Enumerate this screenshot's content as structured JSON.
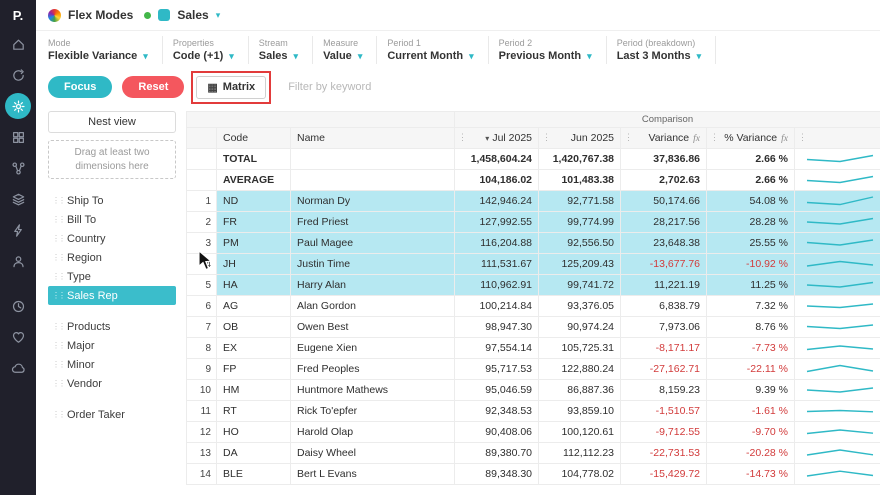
{
  "colors": {
    "accent_teal": "#2fb9c6",
    "reset_red": "#f4575e",
    "row_highlight": "#b6e8f2",
    "negative_value": "#d23b3b",
    "annotation_red": "#e23b3b",
    "sparkline": "#2fb9c6"
  },
  "app": {
    "logo_text": "P.",
    "title": "Flex Modes",
    "database": "Sales"
  },
  "sidebar": {
    "icons": [
      "home-icon",
      "refresh-icon",
      "tools-icon",
      "grid-icon",
      "connections-icon",
      "layers-icon",
      "bolt-icon",
      "users-icon",
      "history-icon",
      "heart-icon",
      "cloud-icon"
    ],
    "active_icon": "tools-icon"
  },
  "toolbar": {
    "controls": [
      {
        "label": "Mode",
        "value": "Flexible Variance"
      },
      {
        "label": "Properties",
        "value": "Code (+1)"
      },
      {
        "label": "Stream",
        "value": "Sales"
      },
      {
        "label": "Measure",
        "value": "Value"
      },
      {
        "label": "Period 1",
        "value": "Current Month"
      },
      {
        "label": "Period 2",
        "value": "Previous Month"
      },
      {
        "label": "Period (breakdown)",
        "value": "Last 3 Months"
      }
    ]
  },
  "actions": {
    "focus_label": "Focus",
    "reset_label": "Reset",
    "matrix_label": "Matrix",
    "filter_placeholder": "Filter by keyword"
  },
  "nest_panel": {
    "title": "Nest view",
    "drop_hint": "Drag at least two dimensions here",
    "active_item": "Sales Rep",
    "groups": [
      [
        "Ship To",
        "Bill To",
        "Country",
        "Region",
        "Type",
        "Sales Rep"
      ],
      [
        "Products",
        "Major",
        "Minor",
        "Vendor"
      ],
      [
        "Order Taker"
      ]
    ]
  },
  "table": {
    "group_header": "Comparison",
    "columns": [
      {
        "key": "code",
        "label": "Code",
        "align": "left"
      },
      {
        "key": "name",
        "label": "Name",
        "align": "left"
      },
      {
        "key": "jul-2025",
        "label": "Jul 2025",
        "align": "right",
        "sorted": true,
        "menu": true
      },
      {
        "key": "jun-2025",
        "label": "Jun 2025",
        "align": "right",
        "menu": true
      },
      {
        "key": "variance",
        "label": "Variance",
        "align": "right",
        "fx": true,
        "menu": true
      },
      {
        "key": "pct-variance",
        "label": "% Variance",
        "align": "right",
        "fx": true,
        "menu": true
      },
      {
        "key": "sparkline",
        "label": "",
        "align": "right",
        "menu": true,
        "spark": true
      }
    ],
    "summary_rows": [
      {
        "label": "TOTAL",
        "jul": "1,458,604.24",
        "jun": "1,420,767.38",
        "variance": "37,836.86",
        "pct_variance": "2.66 %",
        "spark": [
          0.45,
          0.25,
          0.85
        ]
      },
      {
        "label": "AVERAGE",
        "jul": "104,186.02",
        "jun": "101,483.38",
        "variance": "2,702.63",
        "pct_variance": "2.66 %",
        "spark": [
          0.45,
          0.25,
          0.85
        ]
      }
    ],
    "rows": [
      {
        "n": 1,
        "code": "ND",
        "name": "Norman Dy",
        "jul": "142,946.24",
        "jun": "92,771.58",
        "variance": "50,174.66",
        "pct_variance": "54.08 %",
        "highlight": true,
        "spark": [
          0.35,
          0.15,
          0.9
        ]
      },
      {
        "n": 2,
        "code": "FR",
        "name": "Fred Priest",
        "jul": "127,992.55",
        "jun": "99,774.99",
        "variance": "28,217.56",
        "pct_variance": "28.28 %",
        "highlight": true,
        "spark": [
          0.5,
          0.3,
          0.85
        ]
      },
      {
        "n": 3,
        "code": "PM",
        "name": "Paul Magee",
        "jul": "116,204.88",
        "jun": "92,556.50",
        "variance": "23,648.38",
        "pct_variance": "25.55 %",
        "highlight": true,
        "spark": [
          0.55,
          0.3,
          0.8
        ]
      },
      {
        "n": 4,
        "code": "JH",
        "name": "Justin Time",
        "jul": "111,531.67",
        "jun": "125,209.43",
        "variance": "-13,677.76",
        "pct_variance": "-10.92 %",
        "highlight": true,
        "spark": [
          0.3,
          0.75,
          0.4
        ]
      },
      {
        "n": 5,
        "code": "HA",
        "name": "Harry Alan",
        "jul": "110,962.91",
        "jun": "99,741.72",
        "variance": "11,221.19",
        "pct_variance": "11.25 %",
        "highlight": true,
        "spark": [
          0.5,
          0.3,
          0.75
        ]
      },
      {
        "n": 6,
        "code": "AG",
        "name": "Alan Gordon",
        "jul": "100,214.84",
        "jun": "93,376.05",
        "variance": "6,838.79",
        "pct_variance": "7.32 %",
        "highlight": false,
        "spark": [
          0.5,
          0.35,
          0.7
        ]
      },
      {
        "n": 7,
        "code": "OB",
        "name": "Owen Best",
        "jul": "98,947.30",
        "jun": "90,974.24",
        "variance": "7,973.06",
        "pct_variance": "8.76 %",
        "highlight": false,
        "spark": [
          0.55,
          0.35,
          0.7
        ]
      },
      {
        "n": 8,
        "code": "EX",
        "name": "Eugene Xien",
        "jul": "97,554.14",
        "jun": "105,725.31",
        "variance": "-8,171.17",
        "pct_variance": "-7.73 %",
        "highlight": false,
        "spark": [
          0.35,
          0.7,
          0.4
        ]
      },
      {
        "n": 9,
        "code": "FP",
        "name": "Fred Peoples",
        "jul": "95,717.53",
        "jun": "122,880.24",
        "variance": "-27,162.71",
        "pct_variance": "-22.11 %",
        "highlight": false,
        "spark": [
          0.25,
          0.85,
          0.3
        ]
      },
      {
        "n": 10,
        "code": "HM",
        "name": "Huntmore Mathews",
        "jul": "95,046.59",
        "jun": "86,887.36",
        "variance": "8,159.23",
        "pct_variance": "9.39 %",
        "highlight": false,
        "spark": [
          0.5,
          0.3,
          0.7
        ]
      },
      {
        "n": 11,
        "code": "RT",
        "name": "Rick To'epfer",
        "jul": "92,348.53",
        "jun": "93,859.10",
        "variance": "-1,510.57",
        "pct_variance": "-1.61 %",
        "highlight": false,
        "spark": [
          0.45,
          0.55,
          0.42
        ]
      },
      {
        "n": 12,
        "code": "HO",
        "name": "Harold Olap",
        "jul": "90,408.06",
        "jun": "100,120.61",
        "variance": "-9,712.55",
        "pct_variance": "-9.70 %",
        "highlight": false,
        "spark": [
          0.35,
          0.7,
          0.38
        ]
      },
      {
        "n": 13,
        "code": "DA",
        "name": "Daisy Wheel",
        "jul": "89,380.70",
        "jun": "112,112.23",
        "variance": "-22,731.53",
        "pct_variance": "-20.28 %",
        "highlight": false,
        "spark": [
          0.3,
          0.8,
          0.32
        ]
      },
      {
        "n": 14,
        "code": "BLE",
        "name": "Bert L Evans",
        "jul": "89,348.30",
        "jun": "104,778.02",
        "variance": "-15,429.72",
        "pct_variance": "-14.73 %",
        "highlight": false,
        "spark": [
          0.3,
          0.78,
          0.35
        ]
      }
    ]
  }
}
